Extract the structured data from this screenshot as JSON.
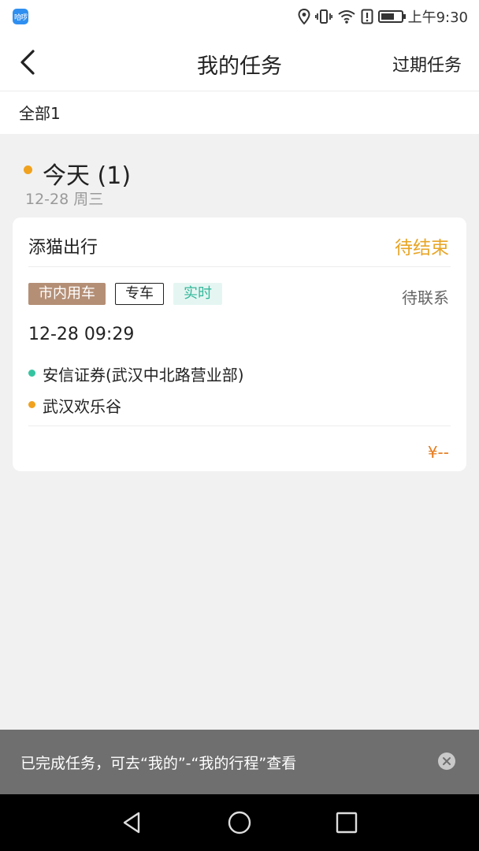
{
  "status_bar": {
    "app_badge": "哈啰",
    "time": "上午9:30"
  },
  "header": {
    "title": "我的任务",
    "action": "过期任务",
    "back_icon": "chevron-left-icon"
  },
  "filter": {
    "tab_all": "全部1"
  },
  "day_group": {
    "title": "今天 (1)",
    "date": "12-28 周三",
    "dot_color": "#f0a21e"
  },
  "task": {
    "company": "添猫出行",
    "status": "待结束",
    "tags": [
      "市内用车",
      "专车",
      "实时"
    ],
    "contact_status": "待联系",
    "time": "12-28 09:29",
    "from": "安信证券(武汉中北路营业部)",
    "to": "武汉欢乐谷",
    "price": "¥--",
    "colors": {
      "status": "#e7a526",
      "from_dot": "#35c4a0",
      "to_dot": "#f0a21e",
      "price": "#e67b1c"
    }
  },
  "toast": {
    "message": "已完成任务，可去“我的”-“我的行程”查看",
    "close_icon": "close-circle-icon"
  },
  "system_nav": {
    "icons": [
      "back-triangle-icon",
      "home-circle-icon",
      "recents-square-icon"
    ]
  }
}
